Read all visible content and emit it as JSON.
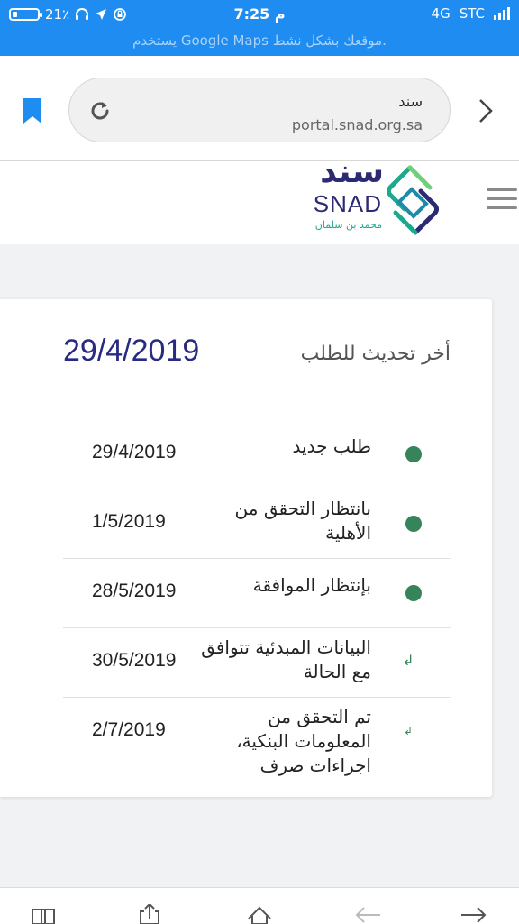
{
  "status_bar": {
    "battery": "21٪",
    "battery_level": 0.21,
    "time": "7:25 م",
    "network": "4G",
    "carrier": "STC",
    "maps_banner": "يستخدم Google Maps موقعك بشكل نشط."
  },
  "url_bar": {
    "title": "سند",
    "host": "portal.snad.org.sa"
  },
  "logo": {
    "arabic": "سند",
    "english": "SNAD",
    "tagline": "محمد بن سلمان"
  },
  "request": {
    "last_update_label": "أخر تحديث للطلب",
    "last_update_date": "29/4/2019",
    "steps": [
      {
        "status": "طلب جديد",
        "date": "29/4/2019",
        "marker": "dot"
      },
      {
        "status": "بانتظار التحقق من الأهلية",
        "date": "1/5/2019",
        "marker": "dot"
      },
      {
        "status": "بإنتظار الموافقة",
        "date": "28/5/2019",
        "marker": "dot"
      },
      {
        "status": "البيانات المبدئية تتوافق مع الحالة",
        "date": "30/5/2019",
        "marker": "return-arrow"
      },
      {
        "status": "تم التحقق من المعلومات البنكية، اجراءات صرف",
        "date": "2/7/2019",
        "marker": "return-arrow"
      }
    ]
  },
  "icons": {
    "bookmark": "bookmark-icon",
    "reload": "reload-icon",
    "back": "chevron-right-icon",
    "menu": "hamburger-menu-icon"
  },
  "colors": {
    "status_bar": "#1e8cf0",
    "brand_dark": "#2c2a72",
    "brand_green": "#1ea98e",
    "step_dot": "#35845a"
  }
}
